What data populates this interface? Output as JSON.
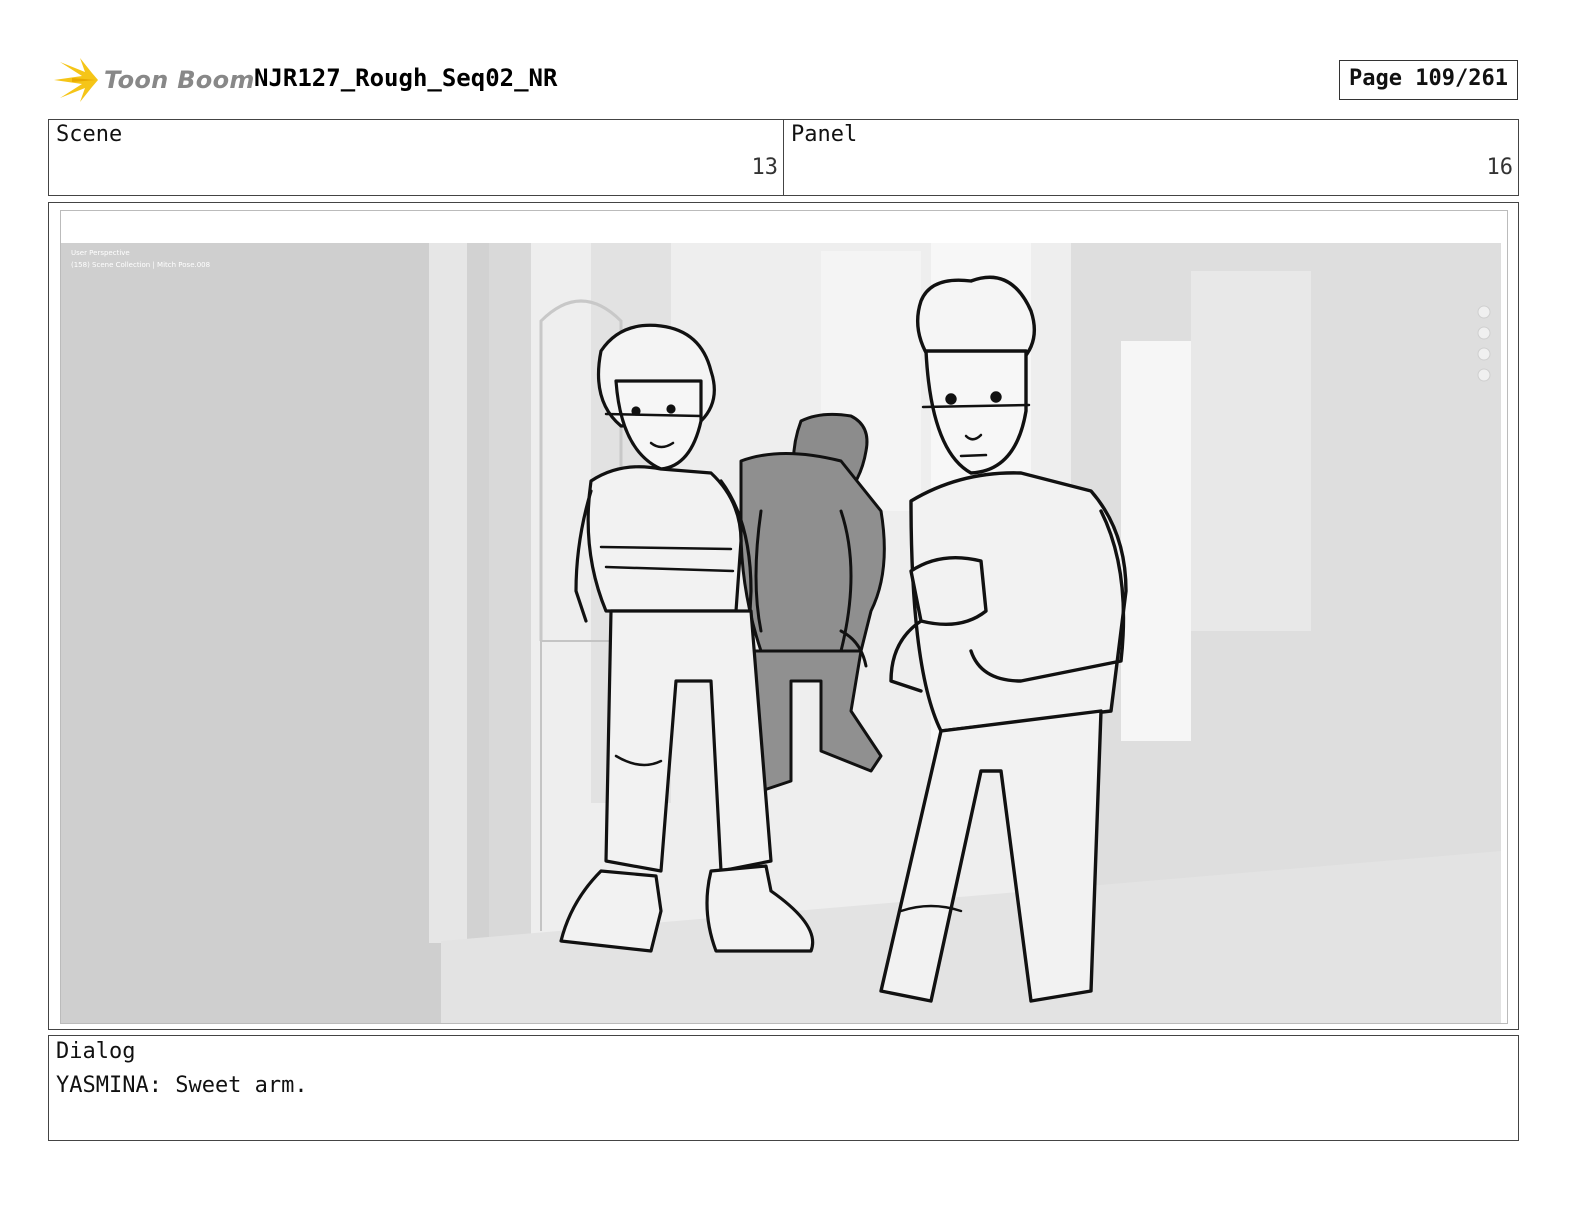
{
  "header": {
    "logo_text": "Toon Boom",
    "title": "NJR127_Rough_Seq02_NR",
    "page_label": "Page 109/261"
  },
  "info": {
    "scene_label": "Scene",
    "scene_value": "13",
    "panel_label": "Panel",
    "panel_value": "16"
  },
  "panel_image": {
    "viewport_line1": "User Perspective",
    "viewport_line2": "(158) Scene Collection | Mitch Pose.008",
    "icons": [
      "zoom-icon",
      "hand-icon",
      "camera-icon",
      "grid-icon"
    ]
  },
  "dialog": {
    "label": "Dialog",
    "text": "YASMINA: Sweet arm."
  },
  "colors": {
    "logo_star": "#f5c518",
    "logo_text": "#888888",
    "sky_gray": "#d6d6d6",
    "ink": "#111111"
  }
}
